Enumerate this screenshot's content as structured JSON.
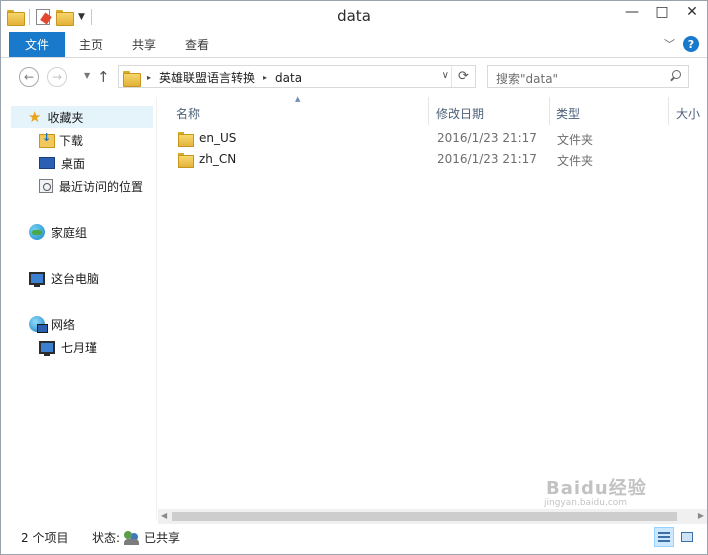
{
  "window": {
    "title": "data"
  },
  "quick_access_toolbar": {
    "icons": [
      "folder-icon",
      "properties-icon",
      "new-folder-icon",
      "customize-dropdown-icon"
    ]
  },
  "window_controls": {
    "minimize": "—",
    "maximize": "□",
    "close": "✕"
  },
  "ribbon": {
    "file_tab": "文件",
    "tabs": [
      "主页",
      "共享",
      "查看"
    ],
    "collapse_icon": "chevron-down-icon",
    "help_label": "?"
  },
  "navigation": {
    "back": "back-arrow-icon",
    "forward": "forward-arrow-icon",
    "up": "up-arrow-icon",
    "recent": "recent-locations-icon"
  },
  "address_bar": {
    "segments": [
      "英雄联盟语言转换",
      "data"
    ],
    "separator": "▸",
    "refresh_icon": "refresh-icon"
  },
  "search": {
    "placeholder": "搜索\"data\""
  },
  "nav_pane": {
    "favorites": {
      "label": "收藏夹",
      "items": [
        "下载",
        "桌面",
        "最近访问的位置"
      ]
    },
    "homegroup": {
      "label": "家庭组"
    },
    "this_pc": {
      "label": "这台电脑"
    },
    "network": {
      "label": "网络",
      "items": [
        "七月瑾"
      ]
    }
  },
  "file_list": {
    "columns": [
      "名称",
      "修改日期",
      "类型",
      "大小"
    ],
    "rows": [
      {
        "name": "en_US",
        "date": "2016/1/23 21:17",
        "type": "文件夹"
      },
      {
        "name": "zh_CN",
        "date": "2016/1/23 21:17",
        "type": "文件夹"
      }
    ]
  },
  "status_bar": {
    "item_count": "2 个项目",
    "state_label": "状态:",
    "state_value": "已共享"
  },
  "watermark": {
    "logo": "Baidu经验",
    "url": "jingyan.baidu.com"
  },
  "colors": {
    "accent": "#1979ca",
    "selection": "#e5f3fb",
    "column_header": "#4c607a"
  }
}
